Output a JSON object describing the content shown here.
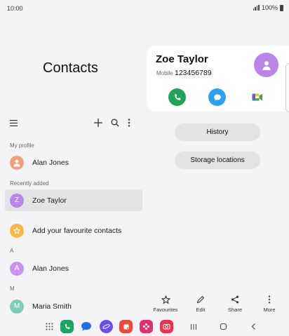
{
  "status": {
    "time": "10:00",
    "battery": "100%"
  },
  "app": {
    "title": "Contacts"
  },
  "toolbar": {
    "menu_icon": "menu-icon",
    "add_icon": "add-icon",
    "search_icon": "search-icon",
    "more_icon": "more-vert-icon"
  },
  "sections": {
    "my_profile": "My profile",
    "recently_added": "Recently added",
    "letter_a": "A",
    "letter_m": "M"
  },
  "rows": {
    "profile": {
      "name": "Alan Jones",
      "color": "#f0a07a"
    },
    "recent": {
      "name": "Zoe Taylor",
      "initial": "Z",
      "color": "#b986e8"
    },
    "favourites": {
      "label": "Add your favourite contacts",
      "color": "#f7b84b"
    },
    "a_contact": {
      "name": "Alan Jones",
      "initial": "A",
      "color": "#c793ee"
    },
    "m_contact": {
      "name": "Maria Smith",
      "initial": "M",
      "color": "#7fcbb8"
    }
  },
  "card": {
    "name": "Zoe Taylor",
    "mobile_label": "Mobile",
    "number": "123456789",
    "actions": [
      "phone-icon",
      "message-icon",
      "video-call-icon"
    ]
  },
  "buttons": {
    "history": "History",
    "storage": "Storage locations"
  },
  "bottom_actions": [
    {
      "label": "Favourites",
      "icon": "star-icon"
    },
    {
      "label": "Edit",
      "icon": "pencil-icon"
    },
    {
      "label": "Share",
      "icon": "share-icon"
    },
    {
      "label": "More",
      "icon": "more-vert-icon"
    }
  ],
  "navbar": {
    "dock_apps": [
      "phone-app",
      "messages-app",
      "internet-app",
      "notes-app",
      "gallery-app",
      "camera-app"
    ],
    "buttons": [
      "recents-icon",
      "home-icon",
      "back-icon"
    ]
  },
  "colors": {
    "call": "#21a35a",
    "message": "#2f9ff0",
    "accent": "#b986e8"
  }
}
